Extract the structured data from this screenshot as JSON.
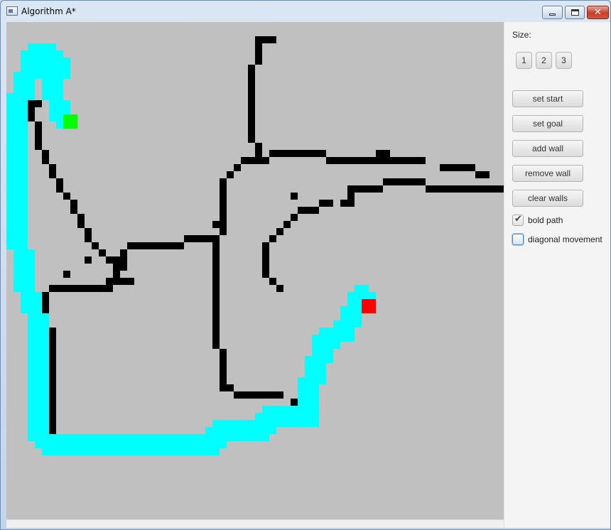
{
  "window": {
    "title": "Algorithm A*"
  },
  "grid": {
    "cols": 70,
    "rows": 70,
    "colors": {
      "background": "#c0c0c0",
      "wall": "#000000",
      "path": "#00ffff",
      "start": "#00ff00",
      "goal": "#ff0000"
    },
    "start": [
      8,
      13
    ],
    "goal": [
      50,
      39
    ],
    "path_bold": true
  },
  "panel": {
    "size_label": "Size:",
    "size_buttons": [
      "1",
      "2",
      "3"
    ],
    "buttons": {
      "set_start": "set start",
      "set_goal": "set goal",
      "add_wall": "add wall",
      "remove_wall": "remove wall",
      "clear_walls": "clear walls"
    },
    "checkboxes": {
      "bold_path": {
        "label": "bold path",
        "checked": true
      },
      "diagonal_movement": {
        "label": "diagonal movement",
        "checked": false
      }
    }
  }
}
